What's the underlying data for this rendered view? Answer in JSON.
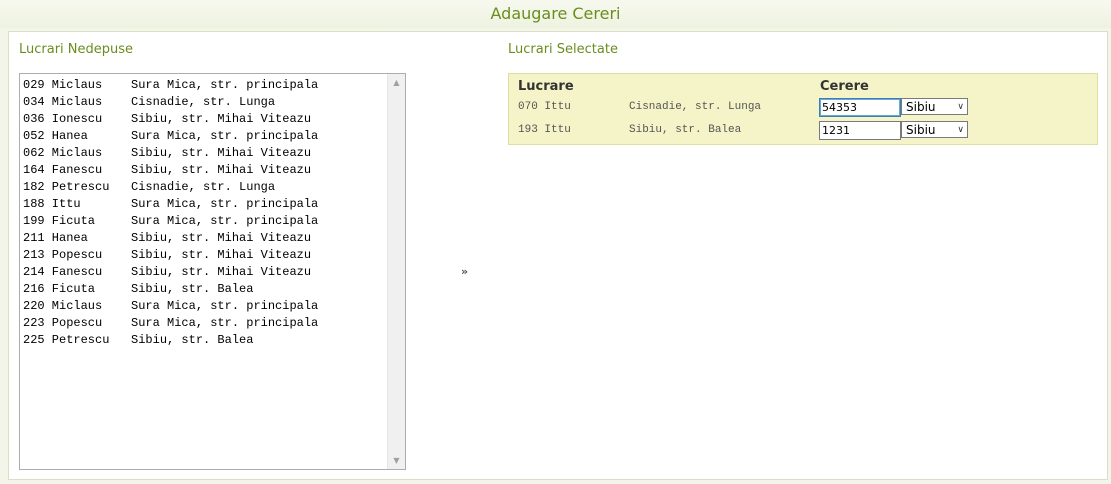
{
  "page": {
    "title": "Adaugare Cereri"
  },
  "left": {
    "title": "Lucrari Nedepuse",
    "items": [
      "029 Miclaus    Sura Mica, str. principala",
      "034 Miclaus    Cisnadie, str. Lunga",
      "036 Ionescu    Sibiu, str. Mihai Viteazu",
      "052 Hanea      Sura Mica, str. principala",
      "062 Miclaus    Sibiu, str. Mihai Viteazu",
      "164 Fanescu    Sibiu, str. Mihai Viteazu",
      "182 Petrescu   Cisnadie, str. Lunga",
      "188 Ittu       Sura Mica, str. principala",
      "199 Ficuta     Sura Mica, str. principala",
      "211 Hanea      Sibiu, str. Mihai Viteazu",
      "213 Popescu    Sibiu, str. Mihai Viteazu",
      "214 Fanescu    Sibiu, str. Mihai Viteazu",
      "216 Ficuta     Sibiu, str. Balea",
      "220 Miclaus    Sura Mica, str. principala",
      "223 Popescu    Sura Mica, str. principala",
      "225 Petrescu   Sibiu, str. Balea"
    ]
  },
  "move_button": {
    "symbol": "»"
  },
  "right": {
    "title": "Lucrari Selectate",
    "headers": {
      "lucrare": "Lucrare",
      "cerere": "Cerere"
    },
    "rows": [
      {
        "lucrare": "070 Ittu",
        "address": "Cisnadie, str. Lunga",
        "cerere": "54353",
        "judet": "Sibiu"
      },
      {
        "lucrare": "193 Ittu",
        "address": "Sibiu, str. Balea",
        "cerere": "1231",
        "judet": "Sibiu"
      }
    ]
  },
  "colors": {
    "accent": "#6a8d1e",
    "selected_bg": "#f4f4c8"
  }
}
